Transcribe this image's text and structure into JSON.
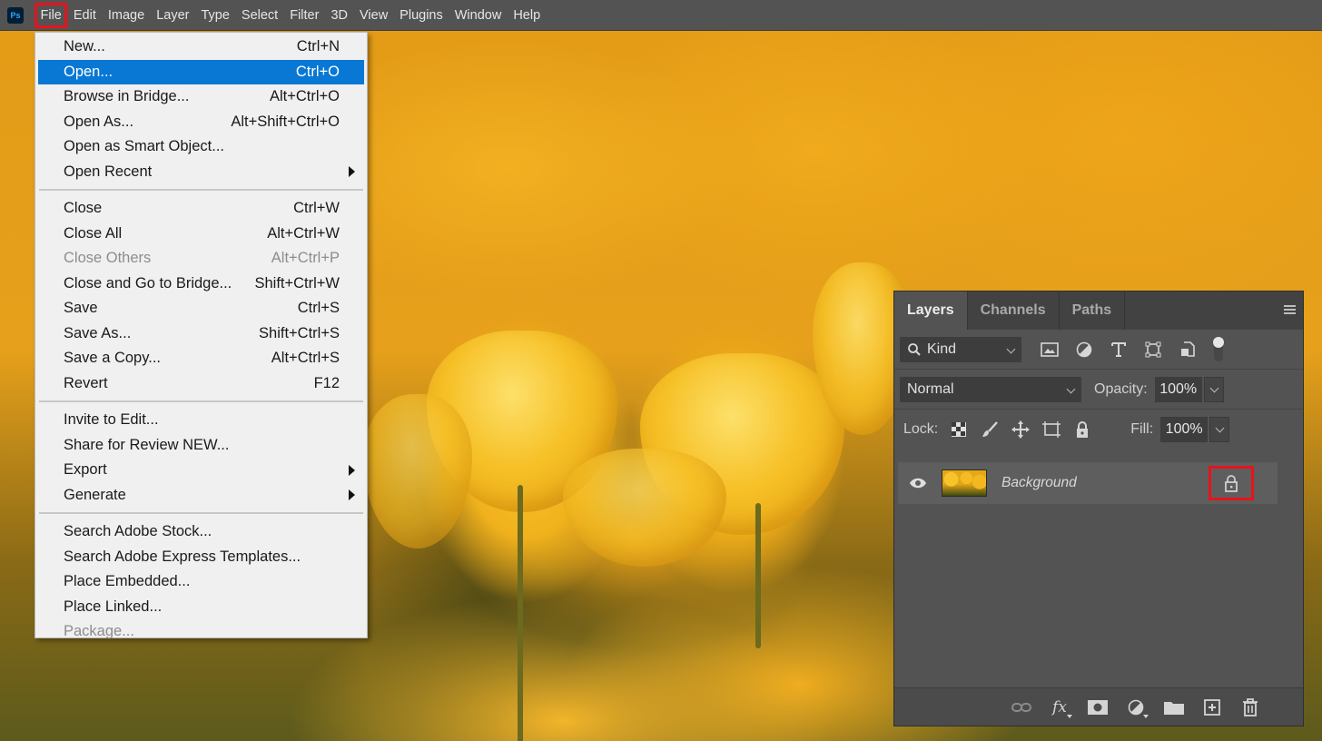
{
  "app": {
    "logo": "Ps",
    "accent_highlight": "#e8131b",
    "selected_color": "#0878d4"
  },
  "menubar": {
    "items": [
      "File",
      "Edit",
      "Image",
      "Layer",
      "Type",
      "Select",
      "Filter",
      "3D",
      "View",
      "Plugins",
      "Window",
      "Help"
    ],
    "highlighted": "File"
  },
  "file_menu": {
    "groups": [
      [
        {
          "label": "New...",
          "shortcut": "Ctrl+N"
        },
        {
          "label": "Open...",
          "shortcut": "Ctrl+O",
          "selected": true
        },
        {
          "label": "Browse in Bridge...",
          "shortcut": "Alt+Ctrl+O"
        },
        {
          "label": "Open As...",
          "shortcut": "Alt+Shift+Ctrl+O"
        },
        {
          "label": "Open as Smart Object...",
          "shortcut": ""
        },
        {
          "label": "Open Recent",
          "shortcut": "",
          "submenu": true
        }
      ],
      [
        {
          "label": "Close",
          "shortcut": "Ctrl+W"
        },
        {
          "label": "Close All",
          "shortcut": "Alt+Ctrl+W"
        },
        {
          "label": "Close Others",
          "shortcut": "Alt+Ctrl+P",
          "disabled": true
        },
        {
          "label": "Close and Go to Bridge...",
          "shortcut": "Shift+Ctrl+W"
        },
        {
          "label": "Save",
          "shortcut": "Ctrl+S"
        },
        {
          "label": "Save As...",
          "shortcut": "Shift+Ctrl+S"
        },
        {
          "label": "Save a Copy...",
          "shortcut": "Alt+Ctrl+S"
        },
        {
          "label": "Revert",
          "shortcut": "F12"
        }
      ],
      [
        {
          "label": "Invite to Edit...",
          "shortcut": ""
        },
        {
          "label": "Share for Review NEW...",
          "shortcut": ""
        },
        {
          "label": "Export",
          "shortcut": "",
          "submenu": true
        },
        {
          "label": "Generate",
          "shortcut": "",
          "submenu": true
        }
      ],
      [
        {
          "label": "Search Adobe Stock...",
          "shortcut": ""
        },
        {
          "label": "Search Adobe Express Templates...",
          "shortcut": ""
        },
        {
          "label": "Place Embedded...",
          "shortcut": ""
        },
        {
          "label": "Place Linked...",
          "shortcut": ""
        },
        {
          "label": "Package...",
          "shortcut": "",
          "disabled": true
        }
      ]
    ]
  },
  "layers_panel": {
    "tabs": [
      "Layers",
      "Channels",
      "Paths"
    ],
    "active_tab": "Layers",
    "filter": {
      "label": "Kind",
      "icons": [
        "image-filter-icon",
        "adjustment-filter-icon",
        "type-filter-icon",
        "shape-filter-icon",
        "smart-object-filter-icon",
        "filter-toggle-icon"
      ]
    },
    "blend_mode": "Normal",
    "opacity_label": "Opacity:",
    "opacity_value": "100%",
    "lock_label": "Lock:",
    "fill_label": "Fill:",
    "fill_value": "100%",
    "layers": [
      {
        "name": "Background",
        "visible": true,
        "locked": true
      }
    ],
    "footer_icons": [
      "link-layers-icon",
      "fx-icon",
      "layer-mask-icon",
      "adjustment-layer-icon",
      "group-folder-icon",
      "new-layer-icon",
      "delete-icon"
    ],
    "fx_label": "fx"
  }
}
